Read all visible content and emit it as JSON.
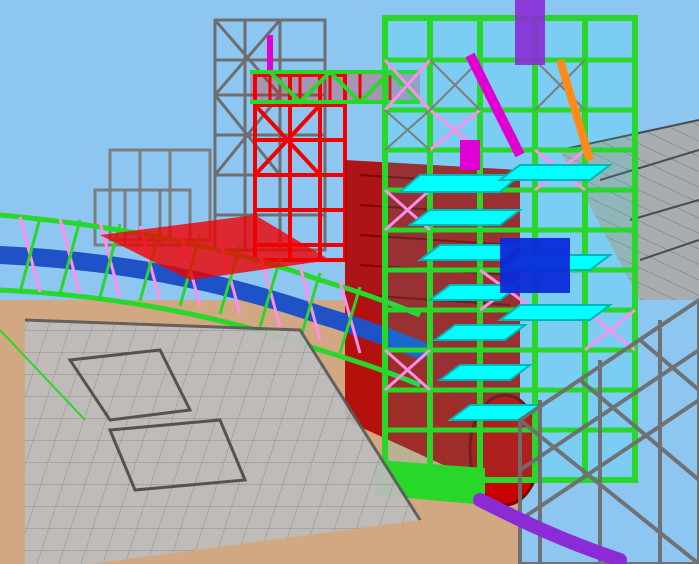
{
  "scene": {
    "colors": {
      "sky": "#8ec6f2",
      "steel_green": "#29d62a",
      "steel_red": "#f00000",
      "steel_gray": "#7d7d7d",
      "bracing_pink": "#ff8ee8",
      "platform_cyan": "#00ffff",
      "conveyor_blue": "#1f52c7",
      "ground_tan": "#d6a77b",
      "wall_gray": "#b9b9b9",
      "magenta": "#e000d4",
      "purple": "#8b2bd6",
      "orange": "#ff8a1a"
    }
  }
}
